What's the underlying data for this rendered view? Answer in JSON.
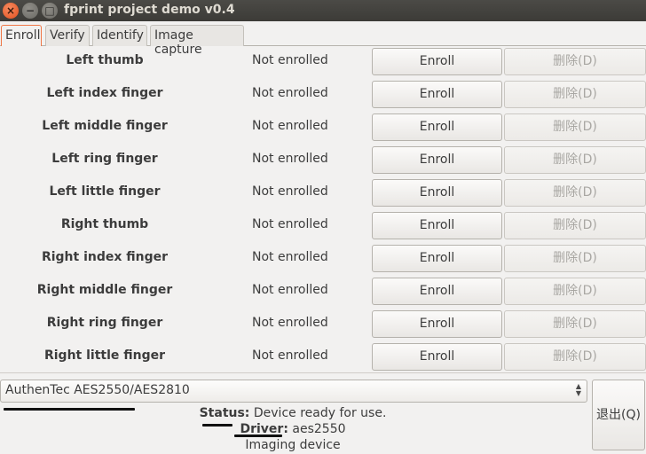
{
  "window": {
    "title": "fprint project demo v0.4",
    "controls": [
      "close-icon",
      "minimize-icon",
      "maximize-icon"
    ]
  },
  "tabs": [
    {
      "label": "Enroll",
      "active": true
    },
    {
      "label": "Verify",
      "active": false
    },
    {
      "label": "Identify",
      "active": false
    },
    {
      "label": "Image capture",
      "active": false
    }
  ],
  "fingers": [
    {
      "name": "Left thumb",
      "status": "Not enrolled",
      "enroll": "Enroll",
      "delete": "删除(D)"
    },
    {
      "name": "Left index finger",
      "status": "Not enrolled",
      "enroll": "Enroll",
      "delete": "删除(D)"
    },
    {
      "name": "Left middle finger",
      "status": "Not enrolled",
      "enroll": "Enroll",
      "delete": "删除(D)"
    },
    {
      "name": "Left ring finger",
      "status": "Not enrolled",
      "enroll": "Enroll",
      "delete": "删除(D)"
    },
    {
      "name": "Left little finger",
      "status": "Not enrolled",
      "enroll": "Enroll",
      "delete": "删除(D)"
    },
    {
      "name": "Right thumb",
      "status": "Not enrolled",
      "enroll": "Enroll",
      "delete": "删除(D)"
    },
    {
      "name": "Right index finger",
      "status": "Not enrolled",
      "enroll": "Enroll",
      "delete": "删除(D)"
    },
    {
      "name": "Right middle finger",
      "status": "Not enrolled",
      "enroll": "Enroll",
      "delete": "删除(D)"
    },
    {
      "name": "Right ring finger",
      "status": "Not enrolled",
      "enroll": "Enroll",
      "delete": "删除(D)"
    },
    {
      "name": "Right little finger",
      "status": "Not enrolled",
      "enroll": "Enroll",
      "delete": "删除(D)"
    }
  ],
  "device": {
    "selected": "AuthenTec AES2550/AES2810",
    "status_label": "Status:",
    "status_value": "Device ready for use.",
    "driver_label": "Driver:",
    "driver_value": "aes2550",
    "type": "Imaging device"
  },
  "quit_label": "退出(Q)",
  "colors": {
    "titlebar": "#3c3b37",
    "close_button": "#e3501f",
    "active_tab_border": "#f07746"
  }
}
